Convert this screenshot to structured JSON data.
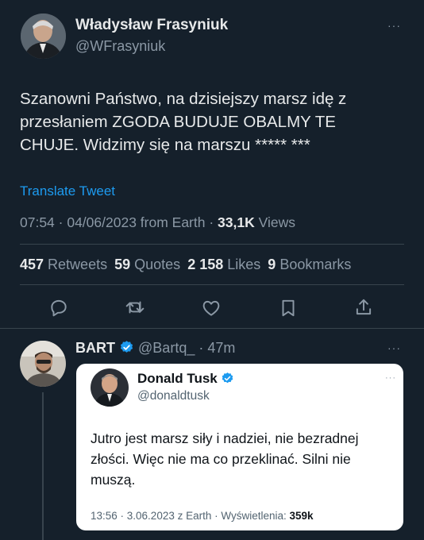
{
  "colors": {
    "background": "#15202b",
    "link": "#1d9bf0",
    "muted": "#8b98a5",
    "verified": "#1d9bf0"
  },
  "main_tweet": {
    "author": {
      "name": "Władysław Frasyniuk",
      "handle": "@WFrasyniuk"
    },
    "more": "···",
    "text_lines": [
      "Szanowni Państwo, na dzisiejszy marsz idę z",
      "przesłaniem ZGODA BUDUJE OBALMY TE",
      "CHUJE. Widzimy się na marszu ***** ***"
    ],
    "translate": "Translate Tweet",
    "meta_prefix": "07:54 · 04/06/2023 from Earth · ",
    "views_count": "33,1K",
    "views_label": " Views",
    "stats": [
      {
        "count": "457",
        "label": " Retweets"
      },
      {
        "count": "59",
        "label": " Quotes"
      },
      {
        "count": "2 158",
        "label": " Likes"
      },
      {
        "count": "9",
        "label": " Bookmarks"
      }
    ],
    "actions": [
      "reply-icon",
      "retweet-icon",
      "like-icon",
      "bookmark-icon",
      "share-icon"
    ]
  },
  "reply": {
    "author": {
      "name": "BART",
      "handle": "@Bartq_",
      "time": "· 47m"
    },
    "more": "···",
    "quote": {
      "author": {
        "name": "Donald Tusk",
        "handle": "@donaldtusk"
      },
      "more": "···",
      "text_lines": [
        "Jutro jest marsz siły i nadziei, nie bezradnej",
        "złości. Więc nie ma co przeklinać. Silni nie",
        "muszą."
      ],
      "meta_prefix": "13:56 · 3.06.2023 z Earth · Wyświetlenia: ",
      "views": "359k"
    }
  }
}
